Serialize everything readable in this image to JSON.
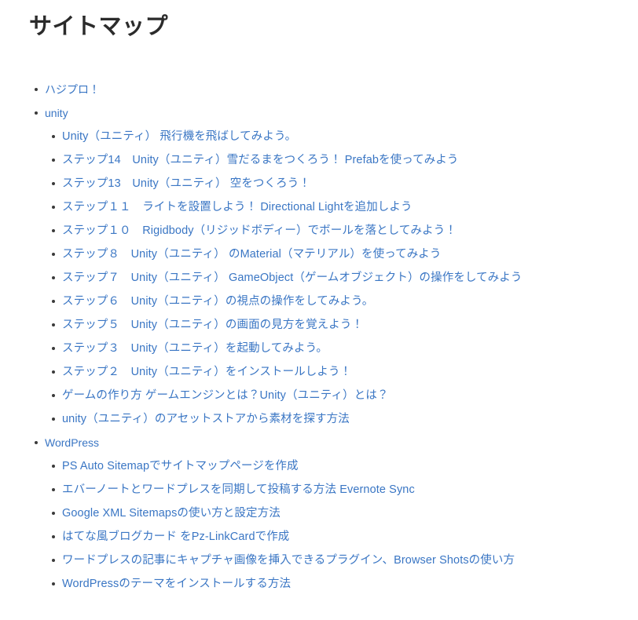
{
  "page": {
    "title": "サイトマップ",
    "background_color": "#ffffff",
    "title_color": "#2b2b2b",
    "link_color": "#3a76c4",
    "bullet_color": "#3a3a3a"
  },
  "sitemap": {
    "items": [
      {
        "label": "ハジプロ！",
        "children": []
      },
      {
        "label": "unity",
        "children": [
          {
            "label": "Unity（ユニティ） 飛行機を飛ばしてみよう。"
          },
          {
            "label": "ステップ14　Unity（ユニティ）雪だるまをつくろう！ Prefabを使ってみよう"
          },
          {
            "label": "ステップ13　Unity（ユニティ） 空をつくろう！"
          },
          {
            "label": "ステップ１１　ライトを設置しよう！ Directional Lightを追加しよう"
          },
          {
            "label": "ステップ１０　Rigidbody（リジッドボディー）でボールを落としてみよう！"
          },
          {
            "label": "ステップ８　Unity（ユニティ） のMaterial（マテリアル）を使ってみよう"
          },
          {
            "label": "ステップ７　Unity（ユニティ） GameObject（ゲームオブジェクト）の操作をしてみよう"
          },
          {
            "label": "ステップ６　Unity（ユニティ）の視点の操作をしてみよう。"
          },
          {
            "label": "ステップ５　Unity（ユニティ）の画面の見方を覚えよう！"
          },
          {
            "label": "ステップ３　Unity（ユニティ）を起動してみよう。"
          },
          {
            "label": "ステップ２　Unity（ユニティ）をインストールしよう！"
          },
          {
            "label": "ゲームの作り方 ゲームエンジンとは？Unity（ユニティ）とは？"
          },
          {
            "label": "unity（ユニティ）のアセットストアから素材を探す方法"
          }
        ]
      },
      {
        "label": "WordPress",
        "children": [
          {
            "label": "PS Auto Sitemapでサイトマップページを作成"
          },
          {
            "label": "エバーノートとワードプレスを同期して投稿する方法 Evernote Sync"
          },
          {
            "label": "Google XML Sitemapsの使い方と設定方法"
          },
          {
            "label": "はてな風ブログカード をPz-LinkCardで作成"
          },
          {
            "label": "ワードプレスの記事にキャプチャ画像を挿入できるプラグイン、Browser Shotsの使い方"
          },
          {
            "label": "WordPressのテーマをインストールする方法"
          }
        ]
      }
    ]
  }
}
